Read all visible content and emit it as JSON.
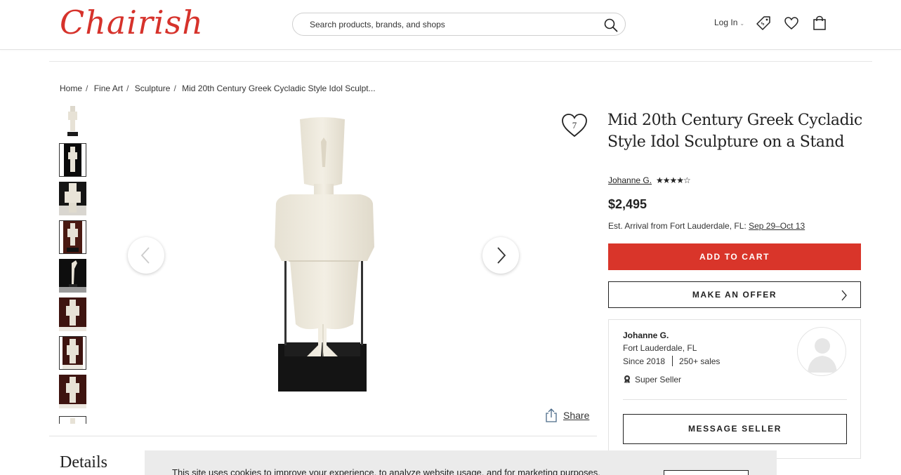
{
  "header": {
    "logo": "Chairish",
    "search_placeholder": "Search products, brands, and shops",
    "login_label": "Log In"
  },
  "breadcrumb": [
    "Home",
    "Fine Art",
    "Sculpture",
    "Mid 20th Century Greek Cycladic Style Idol Sculpt..."
  ],
  "gallery": {
    "favorite_count": "7",
    "share_label": "Share"
  },
  "product": {
    "title": "Mid 20th Century Greek Cycladic Style Idol Sculpture on a Stand",
    "seller_link": "Johanne G.",
    "rating_stars": "★★★★☆",
    "price": "$2,495",
    "arrival_prefix": "Est. Arrival from Fort Lauderdale, FL:",
    "arrival_dates": "Sep 29–Oct 13",
    "add_to_cart": "ADD TO CART",
    "make_offer": "MAKE AN OFFER"
  },
  "seller": {
    "name": "Johanne G.",
    "location": "Fort Lauderdale, FL",
    "since": "Since 2018",
    "sales": "250+ sales",
    "badge": "Super Seller",
    "message_button": "MESSAGE SELLER"
  },
  "sections": {
    "details_heading": "Details"
  },
  "cookie": {
    "text": "This site uses cookies to improve your experience, to analyze website usage, and for marketing purposes."
  },
  "colors": {
    "brand": "#d6322b",
    "cart_button": "#d9352a"
  }
}
